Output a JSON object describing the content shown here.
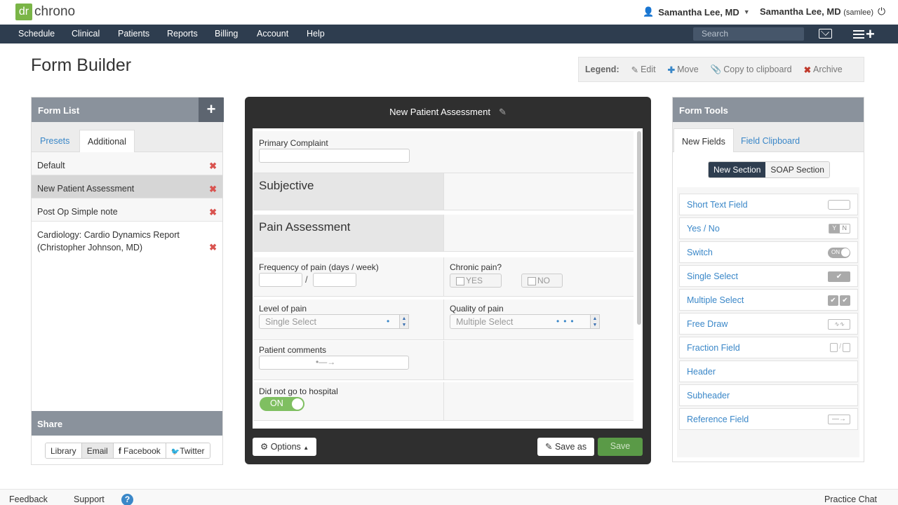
{
  "brand": {
    "logo_mark": "dr",
    "logo_text": "chrono"
  },
  "user": {
    "name": "Samantha Lee, MD",
    "account_name": "Samantha Lee, MD",
    "username": "(samlee)"
  },
  "nav": {
    "items": [
      "Schedule",
      "Clinical",
      "Patients",
      "Reports",
      "Billing",
      "Account",
      "Help"
    ],
    "search_placeholder": "Search"
  },
  "page": {
    "title": "Form Builder"
  },
  "legend": {
    "title": "Legend:",
    "edit": "Edit",
    "move": "Move",
    "copy": "Copy to clipboard",
    "archive": "Archive"
  },
  "form_list": {
    "title": "Form List",
    "tabs": [
      "Presets",
      "Additional"
    ],
    "items": [
      "Default",
      "New Patient Assessment",
      "Post Op Simple note",
      "Cardiology: Cardio Dynamics Report (Christopher Johnson, MD)"
    ],
    "selected": "New Patient Assessment"
  },
  "share": {
    "title": "Share",
    "buttons": [
      "Library",
      "Email",
      "Facebook",
      "Twitter"
    ]
  },
  "builder": {
    "title": "New Patient Assessment",
    "fields": {
      "primary_complaint": "Primary Complaint",
      "subjective": "Subjective",
      "pain_assessment": "Pain Assessment",
      "frequency": "Frequency of pain (days / week)",
      "frequency_sep": "/",
      "chronic": "Chronic pain?",
      "yes": "YES",
      "no": "NO",
      "level": "Level of pain",
      "level_value": "Single Select",
      "quality": "Quality of pain",
      "quality_value": "Multiple Select",
      "comments": "Patient comments",
      "hospital": "Did not go to hospital",
      "hospital_toggle": "ON"
    },
    "options_label": "Options",
    "save_as_label": "Save as",
    "save_label": "Save"
  },
  "form_tools": {
    "title": "Form Tools",
    "tabs": [
      "New Fields",
      "Field Clipboard"
    ],
    "section_toggle": [
      "New Section",
      "SOAP Section"
    ],
    "tools": [
      "Short Text Field",
      "Yes / No",
      "Switch",
      "Single Select",
      "Multiple Select",
      "Free Draw",
      "Fraction Field",
      "Header",
      "Subheader",
      "Reference Field"
    ],
    "icon_labels": {
      "yes": "Y",
      "no": "N",
      "switch": "ON",
      "check": "✔"
    }
  },
  "footer": {
    "feedback": "Feedback",
    "support": "Support",
    "practice_chat": "Practice Chat"
  },
  "colors": {
    "nav": "#2e3d4f",
    "accent": "#3a87c8",
    "brand_green": "#7ab547",
    "save_green": "#5a9a47"
  }
}
